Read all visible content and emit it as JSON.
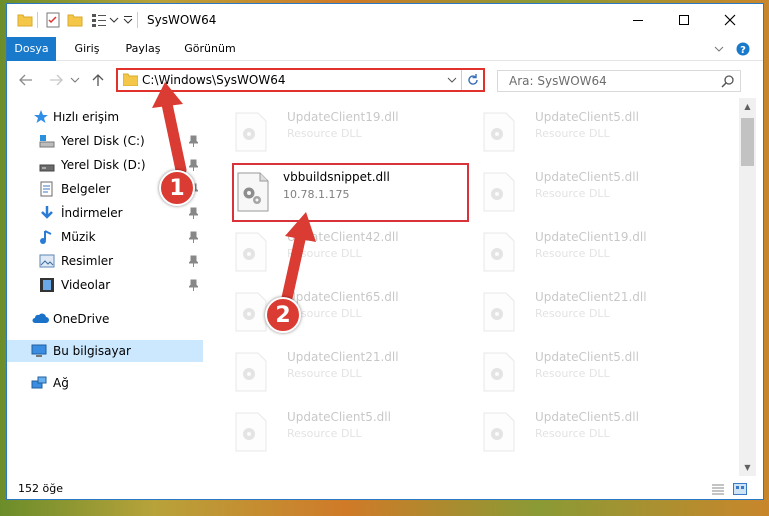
{
  "window": {
    "title": "SysWOW64"
  },
  "ribbon": {
    "tabs": [
      {
        "label": "Dosya",
        "active": true
      },
      {
        "label": "Giriş"
      },
      {
        "label": "Paylaş"
      },
      {
        "label": "Görünüm"
      }
    ]
  },
  "address": {
    "path": "C:\\Windows\\SysWOW64"
  },
  "search": {
    "placeholder": "Ara: SysWOW64"
  },
  "sidebar": {
    "quick_access": "Hızlı erişim",
    "items": [
      {
        "label": "Yerel Disk (C:)",
        "icon": "drive-c-icon",
        "pinned": true
      },
      {
        "label": "Yerel Disk (D:)",
        "icon": "drive-d-icon",
        "pinned": true
      },
      {
        "label": "Belgeler",
        "icon": "documents-icon",
        "pinned": true
      },
      {
        "label": "İndirmeler",
        "icon": "downloads-icon",
        "pinned": true
      },
      {
        "label": "Müzik",
        "icon": "music-icon",
        "pinned": true
      },
      {
        "label": "Resimler",
        "icon": "pictures-icon",
        "pinned": true
      },
      {
        "label": "Videolar",
        "icon": "videos-icon",
        "pinned": true
      }
    ],
    "onedrive": "OneDrive",
    "this_pc": "Bu bilgisayar",
    "network": "Ağ"
  },
  "files": {
    "left_column": [
      {
        "name": "UpdateClient19.dll",
        "desc": "Resource DLL"
      },
      {
        "name": "vbbuildsnippet.dll",
        "desc": "10.78.1.175",
        "highlighted": true
      },
      {
        "name": "UpdateClient42.dll",
        "desc": "Resource DLL"
      },
      {
        "name": "UpdateClient65.dll",
        "desc": "Resource DLL"
      },
      {
        "name": "UpdateClient21.dll",
        "desc": "Resource DLL"
      },
      {
        "name": "UpdateClient5.dll",
        "desc": "Resource DLL"
      }
    ],
    "right_column": [
      {
        "name": "UpdateClient5.dll",
        "desc": "Resource DLL"
      },
      {
        "name": "UpdateClient5.dll",
        "desc": "Resource DLL"
      },
      {
        "name": "UpdateClient19.dll",
        "desc": "Resource DLL"
      },
      {
        "name": "UpdateClient21.dll",
        "desc": "Resource DLL"
      },
      {
        "name": "UpdateClient5.dll",
        "desc": "Resource DLL"
      },
      {
        "name": "UpdateClient5.dll",
        "desc": "Resource DLL"
      }
    ]
  },
  "status": {
    "count": "152 öğe"
  },
  "annotations": {
    "step1": "1",
    "step2": "2",
    "color": "#da3b33"
  }
}
